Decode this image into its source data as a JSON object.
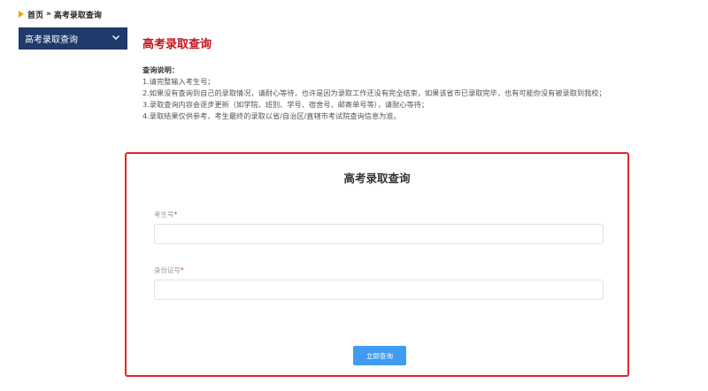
{
  "breadcrumb": {
    "home": "首页",
    "separator": "»",
    "current": "高考录取查询"
  },
  "sidebar": {
    "items": [
      {
        "label": "高考录取查询",
        "icon": "chevron-down-icon"
      }
    ]
  },
  "main": {
    "title": "高考录取查询",
    "instructions": {
      "heading": "查询说明：",
      "lines": [
        "1.请完整输入考生号；",
        "2.如果没有查询到自己的录取情况，请耐心等待，也许是因为录取工作还没有完全结束，如果该省市已录取完毕，也有可能你没有被录取到我校；",
        "3.录取查询内容会逐步更新（如学院、班别、学号、宿舍号、邮寄单号等），请耐心等待；",
        "4.录取结果仅供参考，考生最终的录取以省/自治区/直辖市考试院查询信息为准。"
      ]
    }
  },
  "form": {
    "title": "高考录取查询",
    "fields": [
      {
        "label": "考生号",
        "required_mark": "*",
        "value": "",
        "placeholder": ""
      },
      {
        "label": "身份证号",
        "required_mark": "*",
        "value": "",
        "placeholder": ""
      }
    ],
    "submit_label": "立即查询"
  },
  "colors": {
    "title_red": "#c0141b",
    "border_red": "#e3262b",
    "sidebar_navy": "#1f3a6b",
    "button_blue": "#3f9cf0",
    "breadcrumb_arrow": "#f0a300"
  }
}
